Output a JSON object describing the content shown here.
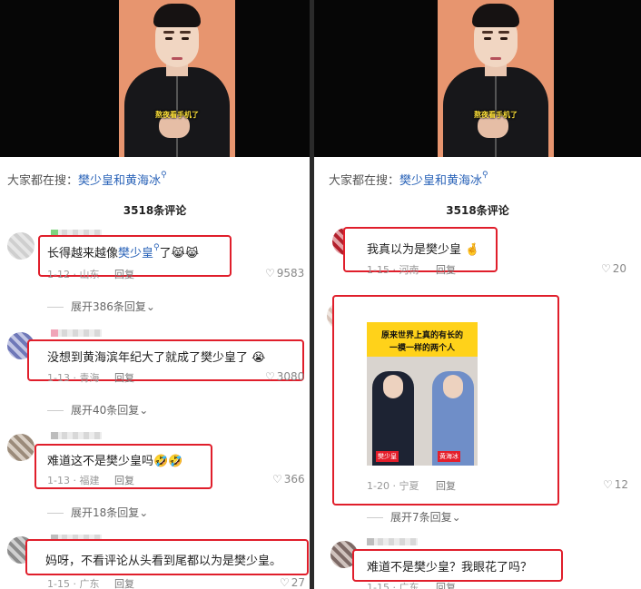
{
  "left": {
    "video_caption": "熬夜看手机了",
    "search": {
      "prefix": "大家都在搜：",
      "keyword": "樊少皇和黄海冰",
      "icon": "search-icon"
    },
    "comment_count": "3518条评论",
    "comments": [
      {
        "text_pre": "长得越来越像",
        "keyword": "樊少皇",
        "text_post": "了😹😹",
        "date": "1-12 · 山东",
        "reply": "回复",
        "likes": "9583",
        "expand": "展开386条回复⌄"
      },
      {
        "text": "没想到黄海滨年纪大了就成了樊少皇了 😭",
        "date": "1-13 · 青海",
        "reply": "回复",
        "likes": "3080",
        "expand": "展开40条回复⌄"
      },
      {
        "text": "难道这不是樊少皇吗🤣🤣",
        "date": "1-13 · 福建",
        "reply": "回复",
        "likes": "366",
        "expand": "展开18条回复⌄"
      },
      {
        "text": "妈呀，不看评论从头看到尾都以为是樊少皇。",
        "date": "1-15 · 广东",
        "reply": "回复",
        "likes": "27"
      }
    ]
  },
  "right": {
    "video_caption": "熬夜看手机了",
    "search": {
      "prefix": "大家都在搜：",
      "keyword": "樊少皇和黄海冰",
      "icon": "search-icon"
    },
    "comment_count": "3518条评论",
    "comments": [
      {
        "text": "我真以为是樊少皇 🤞",
        "date": "1-15 · 河南",
        "reply": "回复",
        "likes": "20"
      },
      {
        "image": {
          "title_line1": "原来世界上真的有长的",
          "title_line2": "一模一样的两个人",
          "tag_left": "樊少皇",
          "tag_right": "黄海冰"
        },
        "date": "1-20 · 宁夏",
        "reply": "回复",
        "likes": "12",
        "expand": "展开7条回复⌄"
      },
      {
        "text": "难道不是樊少皇？我眼花了吗？",
        "date": "1-15 · 广东",
        "reply": "回复"
      }
    ]
  },
  "colors": {
    "highlight_border": "#e01e2b",
    "keyword_link": "#2a63b8",
    "video_bg": "#060606",
    "image_header": "#ffd21a"
  },
  "icons": {
    "like": "heart-icon",
    "expand": "chevron-down-icon",
    "search": "search-icon"
  }
}
